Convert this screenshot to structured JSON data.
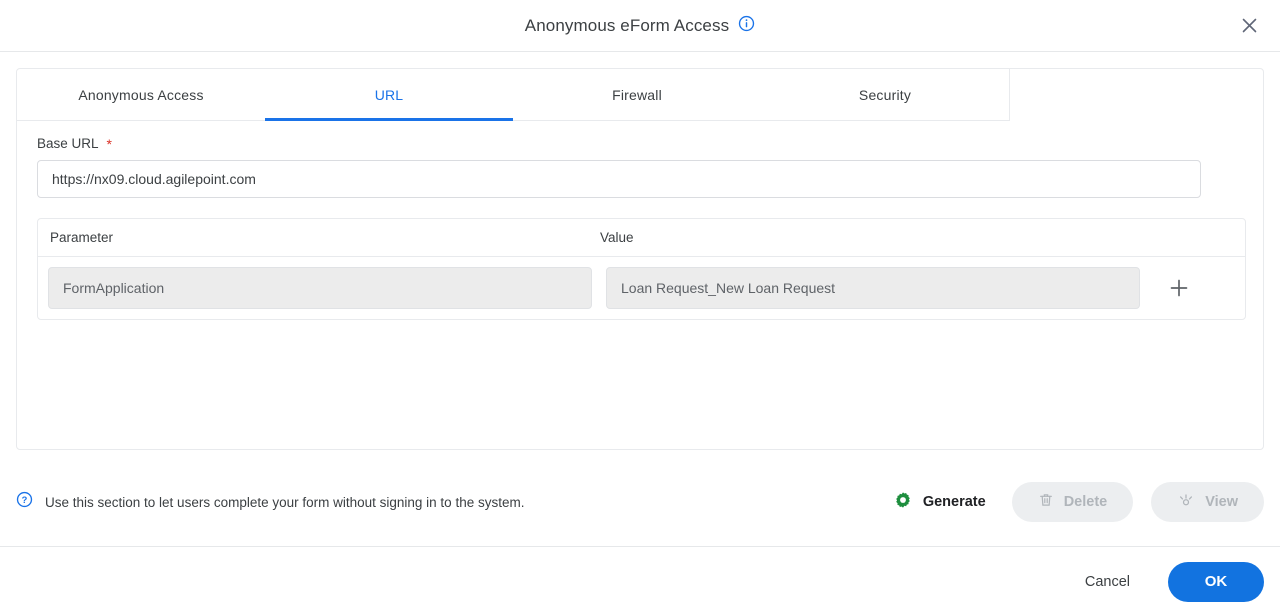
{
  "header": {
    "title": "Anonymous eForm Access",
    "info_icon": "info-circle-icon",
    "close_icon": "close-icon"
  },
  "tabs": [
    {
      "label": "Anonymous Access",
      "active": false
    },
    {
      "label": "URL",
      "active": true
    },
    {
      "label": "Firewall",
      "active": false
    },
    {
      "label": "Security",
      "active": false
    }
  ],
  "form": {
    "base_url_label": "Base URL",
    "required_marker": "*",
    "base_url_value": "https://nx09.cloud.agilepoint.com",
    "base_url_placeholder": "https://nx09.cloud.agilepoint.com"
  },
  "table": {
    "columns": [
      "Parameter",
      "Value"
    ],
    "rows": [
      {
        "parameter": "FormApplication",
        "value": "Loan Request_New Loan Request"
      }
    ],
    "add_icon": "plus-icon"
  },
  "footer": {
    "help_icon": "help-circle-icon",
    "hint": "Use this section to let users complete your form without signing in to the system.",
    "generate": {
      "label": "Generate",
      "icon": "gear-icon",
      "icon_color": "#1e8e3e",
      "disabled": false
    },
    "delete": {
      "label": "Delete",
      "icon": "trash-icon",
      "disabled": true
    },
    "view": {
      "label": "View",
      "icon": "preview-eye-icon",
      "disabled": true
    }
  },
  "actions": {
    "cancel_label": "Cancel",
    "ok_label": "OK",
    "ok_color": "#1273e0"
  }
}
